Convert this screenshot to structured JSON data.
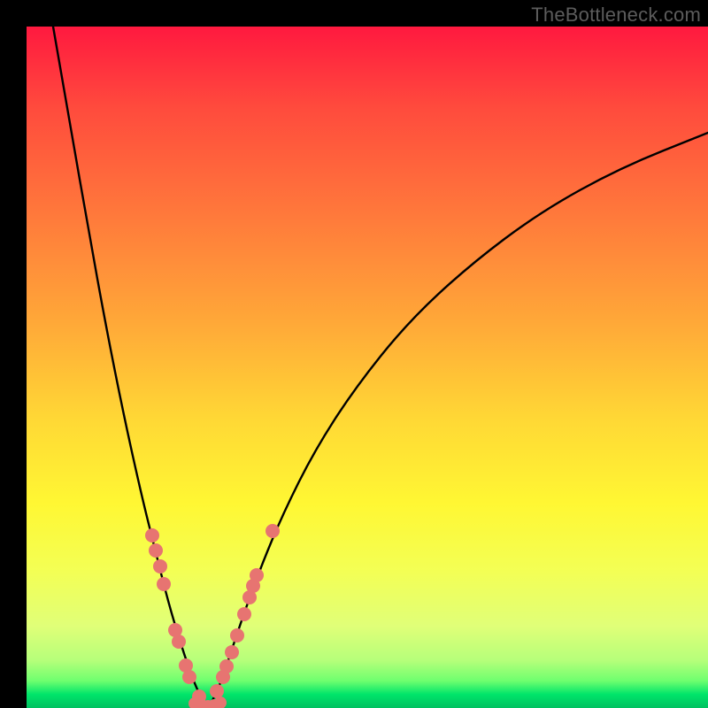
{
  "watermark": "TheBottleneck.com",
  "chart_data": {
    "type": "line",
    "title": "",
    "xlabel": "",
    "ylabel": "",
    "xlim": [
      30,
      800
    ],
    "ylim": [
      30,
      800
    ],
    "note": "Axes and ticks are not labeled in the image; values below are pixel-space coordinates (origin top-left, matching the screenshot). Curves depict a V-shaped bottleneck profile with minimum near x≈230.",
    "series": [
      {
        "name": "left-branch",
        "x": [
          60,
          80,
          100,
          120,
          140,
          160,
          175,
          190,
          205,
          218,
          228,
          235
        ],
        "y": [
          30,
          145,
          260,
          370,
          470,
          560,
          620,
          680,
          730,
          768,
          790,
          798
        ]
      },
      {
        "name": "right-branch",
        "x": [
          235,
          240,
          248,
          260,
          275,
          295,
          320,
          355,
          400,
          460,
          530,
          610,
          700,
          800
        ],
        "y": [
          798,
          792,
          775,
          740,
          695,
          640,
          580,
          510,
          440,
          365,
          300,
          240,
          190,
          150
        ]
      }
    ],
    "markers_left": [
      {
        "x": 172,
        "y": 605
      },
      {
        "x": 176,
        "y": 622
      },
      {
        "x": 181,
        "y": 640
      },
      {
        "x": 185,
        "y": 660
      },
      {
        "x": 198,
        "y": 712
      },
      {
        "x": 202,
        "y": 725
      },
      {
        "x": 210,
        "y": 752
      },
      {
        "x": 214,
        "y": 765
      },
      {
        "x": 225,
        "y": 787
      }
    ],
    "markers_right": [
      {
        "x": 245,
        "y": 781
      },
      {
        "x": 252,
        "y": 765
      },
      {
        "x": 256,
        "y": 753
      },
      {
        "x": 262,
        "y": 737
      },
      {
        "x": 268,
        "y": 718
      },
      {
        "x": 276,
        "y": 694
      },
      {
        "x": 282,
        "y": 675
      },
      {
        "x": 286,
        "y": 662
      },
      {
        "x": 290,
        "y": 650
      },
      {
        "x": 308,
        "y": 600
      }
    ],
    "markers_bottom": [
      {
        "x": 220,
        "y": 795
      },
      {
        "x": 228,
        "y": 797
      },
      {
        "x": 235,
        "y": 798
      },
      {
        "x": 242,
        "y": 797
      },
      {
        "x": 249,
        "y": 794
      }
    ],
    "marker_color": "#e77471",
    "curve_color": "#000000"
  }
}
